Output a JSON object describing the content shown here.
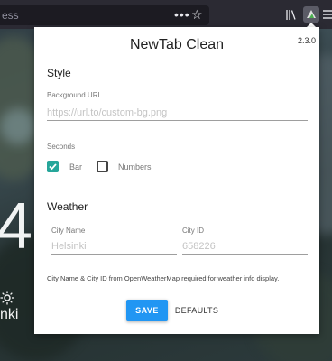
{
  "browser": {
    "url_text": "ess",
    "icons": {
      "more": "more-icon",
      "bookmark": "star-icon",
      "library": "library-icon",
      "extension": "extension-icon",
      "menu": "menu-icon"
    }
  },
  "background": {
    "time": "4",
    "city": "nki",
    "weather_icon": "sun-icon"
  },
  "popup": {
    "title": "NewTab Clean",
    "version": "2.3.0",
    "style_section": {
      "heading": "Style",
      "background_url_label": "Background URL",
      "background_url_placeholder": "https://url.to/custom-bg.png",
      "background_url_value": ""
    },
    "seconds_section": {
      "label": "Seconds",
      "options": [
        {
          "label": "Bar",
          "checked": true
        },
        {
          "label": "Numbers",
          "checked": false
        }
      ]
    },
    "weather_section": {
      "heading": "Weather",
      "city_name_label": "City Name",
      "city_name_placeholder": "Helsinki",
      "city_id_label": "City ID",
      "city_id_placeholder": "658226",
      "info_text": "City Name & City ID from OpenWeatherMap required for weather info display."
    },
    "buttons": {
      "save": "SAVE",
      "defaults": "DEFAULTS"
    }
  },
  "colors": {
    "accent": "#26a69a",
    "save_button": "#2196f3",
    "toolbar": "#2b2a33"
  }
}
